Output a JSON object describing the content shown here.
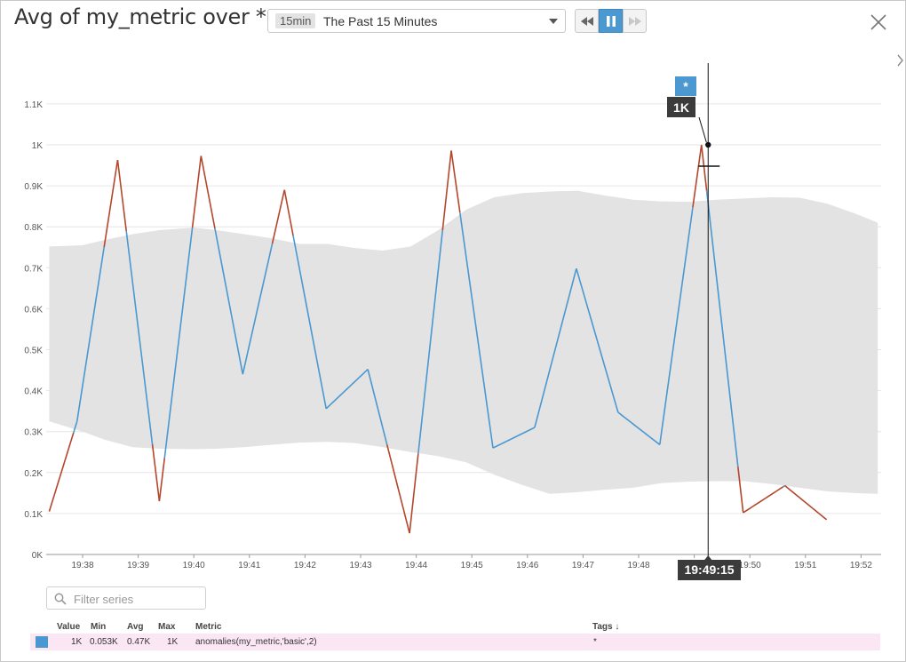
{
  "title": "Avg of my_metric over *",
  "time_selector": {
    "badge": "15min",
    "label": "The Past 15 Minutes"
  },
  "playback": [
    "rewind-button",
    "pause-button",
    "fast-forward-button"
  ],
  "colors": {
    "series_normal": "#4a98d0",
    "series_anomaly": "#b4472b",
    "band": "#e3e3e3",
    "pause_active": "#4c99d2"
  },
  "chart_data": {
    "type": "line",
    "y_ticks": [
      "0K",
      "0.1K",
      "0.2K",
      "0.3K",
      "0.4K",
      "0.5K",
      "0.6K",
      "0.7K",
      "0.8K",
      "0.9K",
      "1K",
      "1.1K"
    ],
    "x_ticks": [
      "19:38",
      "19:39",
      "19:40",
      "19:41",
      "19:42",
      "19:43",
      "19:44",
      "19:45",
      "19:46",
      "19:47",
      "19:48",
      "19:49",
      "19:50",
      "19:51",
      "19:52"
    ],
    "ylim": [
      0,
      1.15
    ],
    "x_unit": "minutes after 19:38",
    "series": [
      {
        "name": "anomalies(my_metric,'basic',2)",
        "x": [
          -0.6,
          -0.1,
          0.63,
          1.38,
          2.13,
          2.88,
          3.63,
          4.38,
          5.13,
          5.88,
          6.63,
          7.38,
          8.13,
          8.88,
          9.63,
          10.38,
          11.13,
          11.88,
          12.63,
          13.38,
          14.13
        ],
        "y": [
          0.105,
          0.325,
          0.963,
          0.13,
          0.973,
          0.44,
          0.89,
          0.356,
          0.452,
          0.052,
          0.986,
          0.26,
          0.31,
          0.698,
          0.347,
          0.268,
          1.0,
          0.102,
          0.168,
          0.085,
          null
        ]
      }
    ],
    "band": {
      "x": [
        -0.6,
        0.0,
        0.4,
        0.9,
        1.4,
        2.0,
        2.4,
        2.9,
        3.4,
        3.9,
        4.4,
        4.9,
        5.4,
        5.9,
        6.4,
        6.9,
        7.4,
        7.9,
        8.4,
        8.9,
        9.4,
        9.9,
        10.4,
        10.9,
        11.4,
        11.9,
        12.4,
        12.9,
        13.4,
        13.9,
        14.3
      ],
      "upper": [
        0.752,
        0.755,
        0.768,
        0.782,
        0.792,
        0.798,
        0.792,
        0.782,
        0.772,
        0.758,
        0.758,
        0.748,
        0.742,
        0.752,
        0.792,
        0.842,
        0.872,
        0.882,
        0.886,
        0.888,
        0.876,
        0.866,
        0.862,
        0.861,
        0.866,
        0.869,
        0.872,
        0.871,
        0.856,
        0.832,
        0.81
      ],
      "lower": [
        0.325,
        0.3,
        0.28,
        0.262,
        0.258,
        0.257,
        0.258,
        0.262,
        0.268,
        0.273,
        0.275,
        0.272,
        0.262,
        0.25,
        0.24,
        0.225,
        0.195,
        0.17,
        0.148,
        0.152,
        0.158,
        0.163,
        0.174,
        0.178,
        0.179,
        0.179,
        0.172,
        0.163,
        0.154,
        0.15,
        0.148
      ]
    },
    "hover": {
      "time": "19:49:15",
      "value_label": "1K",
      "series_tag": "*",
      "x": 11.25,
      "y": 1.0
    }
  },
  "filter": {
    "placeholder": "Filter series"
  },
  "legend": {
    "headers": {
      "value": "Value",
      "min": "Min",
      "avg": "Avg",
      "max": "Max",
      "metric": "Metric",
      "tags": "Tags ↓"
    },
    "rows": [
      {
        "value": "1K",
        "min": "0.053K",
        "avg": "0.47K",
        "max": "1K",
        "metric": "anomalies(my_metric,'basic',2)",
        "tags": "*"
      }
    ]
  }
}
